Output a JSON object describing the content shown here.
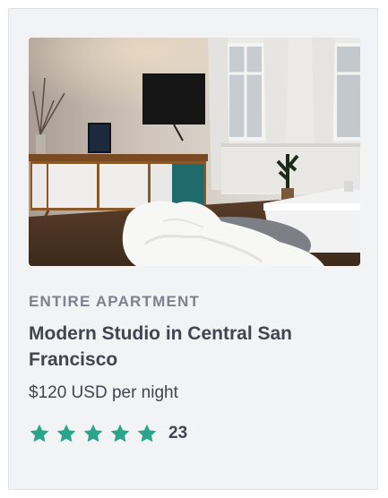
{
  "listing": {
    "type_label": "ENTIRE APARTMENT",
    "title": "Modern Studio in Central San Francisco",
    "price": "$120 USD per night",
    "rating": {
      "stars": 5,
      "max_stars": 5,
      "review_count": "23",
      "star_color": "#2aa58a"
    },
    "photo": {
      "icon": "apartment-photo"
    }
  },
  "colors": {
    "card_background": "#f2f3f5",
    "label": "#7a8290",
    "text": "#3f4551",
    "accent": "#2aa58a"
  }
}
